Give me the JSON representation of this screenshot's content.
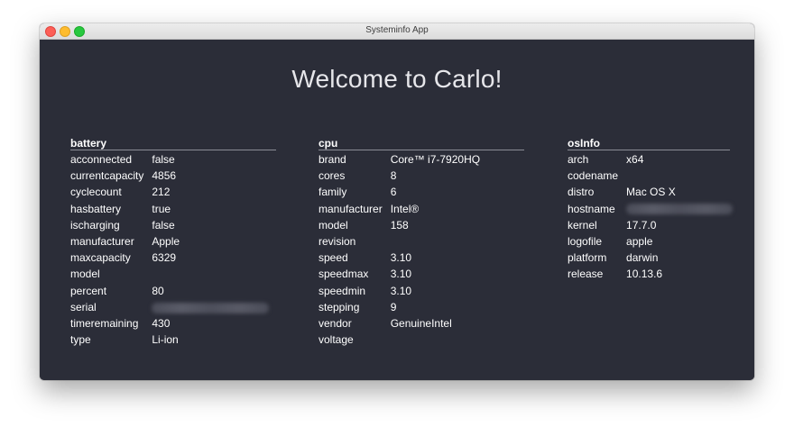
{
  "window": {
    "title": "Systeminfo App"
  },
  "welcome": "Welcome to Carlo!",
  "battery": {
    "header": "battery",
    "rows": [
      {
        "key": "acconnected",
        "value": "false"
      },
      {
        "key": "currentcapacity",
        "value": "4856"
      },
      {
        "key": "cyclecount",
        "value": "212"
      },
      {
        "key": "hasbattery",
        "value": "true"
      },
      {
        "key": "ischarging",
        "value": "false"
      },
      {
        "key": "manufacturer",
        "value": "Apple"
      },
      {
        "key": "maxcapacity",
        "value": "6329"
      },
      {
        "key": "model",
        "value": ""
      },
      {
        "key": "percent",
        "value": "80"
      },
      {
        "key": "serial",
        "value": ""
      },
      {
        "key": "timeremaining",
        "value": "430"
      },
      {
        "key": "type",
        "value": "Li-ion"
      }
    ]
  },
  "cpu": {
    "header": "cpu",
    "rows": [
      {
        "key": "brand",
        "value": "Core™ i7-7920HQ"
      },
      {
        "key": "cores",
        "value": "8"
      },
      {
        "key": "family",
        "value": "6"
      },
      {
        "key": "manufacturer",
        "value": "Intel®"
      },
      {
        "key": "model",
        "value": "158"
      },
      {
        "key": "revision",
        "value": ""
      },
      {
        "key": "speed",
        "value": "3.10"
      },
      {
        "key": "speedmax",
        "value": "3.10"
      },
      {
        "key": "speedmin",
        "value": "3.10"
      },
      {
        "key": "stepping",
        "value": "9"
      },
      {
        "key": "vendor",
        "value": "GenuineIntel"
      },
      {
        "key": "voltage",
        "value": ""
      }
    ]
  },
  "osInfo": {
    "header": "osInfo",
    "rows": [
      {
        "key": "arch",
        "value": "x64"
      },
      {
        "key": "codename",
        "value": ""
      },
      {
        "key": "distro",
        "value": "Mac OS X"
      },
      {
        "key": "hostname",
        "value": ""
      },
      {
        "key": "kernel",
        "value": "17.7.0"
      },
      {
        "key": "logofile",
        "value": "apple"
      },
      {
        "key": "platform",
        "value": "darwin"
      },
      {
        "key": "release",
        "value": "10.13.6"
      }
    ]
  }
}
